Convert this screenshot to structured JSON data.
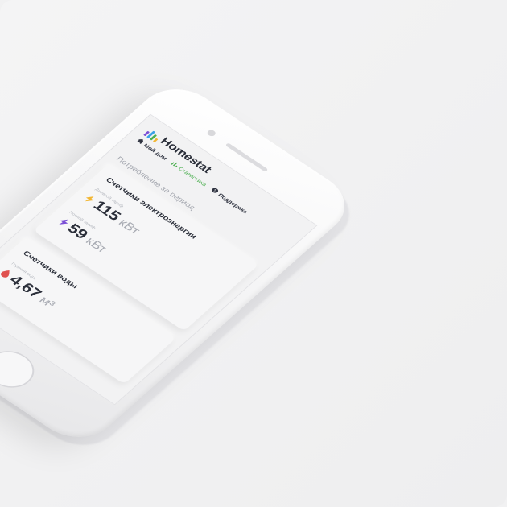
{
  "app": {
    "name": "Homestat"
  },
  "nav": {
    "items": [
      {
        "label": "Мой дом",
        "icon": "home-icon"
      },
      {
        "label": "Статистика",
        "icon": "bar-chart-icon",
        "active": true
      },
      {
        "label": "Поддержка",
        "icon": "help-icon"
      }
    ]
  },
  "main": {
    "section_title": "Потребление за период",
    "electricity": {
      "title": "Счетчики электроэнергии",
      "day": {
        "label": "Дневной тариф",
        "value": "115",
        "unit": "кВт",
        "icon": "lightning-icon",
        "color": "#f2b632"
      },
      "night": {
        "label": "Ночной тариф",
        "value": "59",
        "unit": "кВт",
        "icon": "lightning-icon",
        "color": "#7b4fd6"
      }
    },
    "water": {
      "title": "Счетчики воды",
      "cold": {
        "label": "Горячая вода",
        "value": "4,67",
        "unit": "м³",
        "icon": "water-drop-icon",
        "color": "#e0514f"
      }
    }
  },
  "colors": {
    "accent_green": "#4caf50",
    "logo_bars": [
      "#7b4fd6",
      "#3aa1e6",
      "#4caf50",
      "#f2b632"
    ]
  }
}
